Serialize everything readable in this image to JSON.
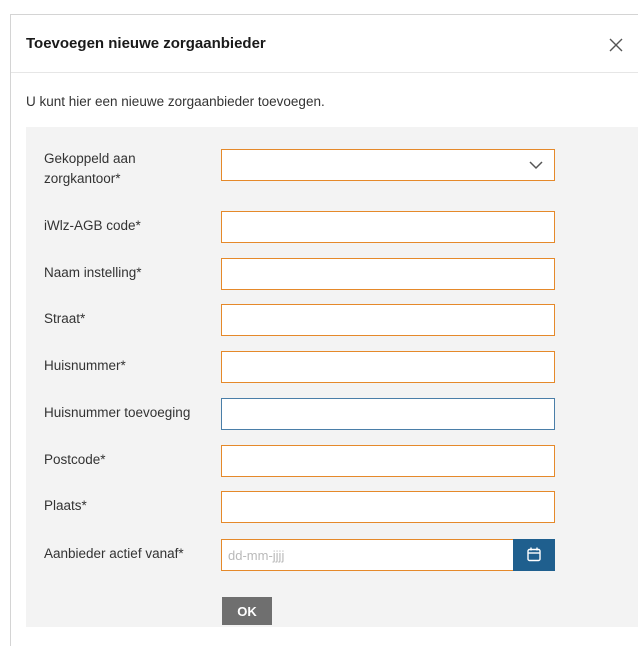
{
  "dialog": {
    "title": "Toevoegen nieuwe zorgaanbieder",
    "intro": "U kunt hier een nieuwe zorgaanbieder toevoegen."
  },
  "form": {
    "zorgkantoor_label": "Gekoppeld aan zorgkantoor*",
    "zorgkantoor_value": "",
    "agb_label": "iWlz-AGB code*",
    "agb_value": "",
    "naam_label": "Naam instelling*",
    "naam_value": "",
    "straat_label": "Straat*",
    "straat_value": "",
    "huisnummer_label": "Huisnummer*",
    "huisnummer_value": "",
    "toevoeging_label": "Huisnummer toevoeging",
    "toevoeging_value": "",
    "postcode_label": "Postcode*",
    "postcode_value": "",
    "plaats_label": "Plaats*",
    "plaats_value": "",
    "actief_label": "Aanbieder actief vanaf*",
    "actief_placeholder": "dd-mm-jjjj",
    "ok_label": "OK"
  },
  "icons": {
    "close": "close-icon",
    "chevron": "chevron-down-icon",
    "calendar": "calendar-icon"
  },
  "colors": {
    "required_border": "#e5892a",
    "focus_border": "#4a7ea8",
    "calendar_button": "#1f5f8e",
    "ok_button": "#6f6f6f",
    "panel_background": "#f3f3f3"
  }
}
